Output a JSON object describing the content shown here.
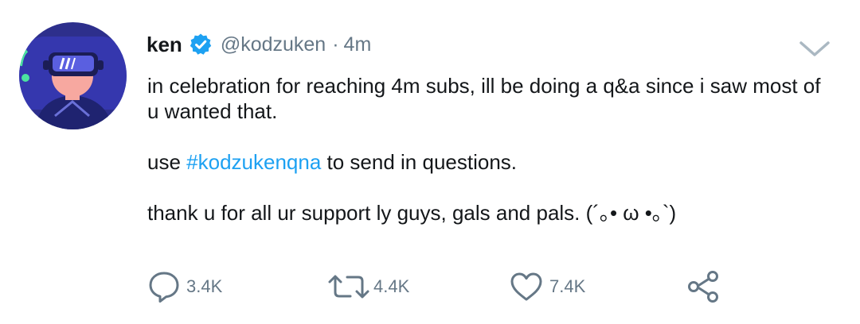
{
  "tweet": {
    "display_name": "ken",
    "handle": "@kodzuken",
    "separator": "·",
    "time": "4m",
    "verified": true,
    "body": {
      "line1": "in celebration for reaching 4m subs, ill be doing a q&a since i saw most of u wanted that.",
      "line2_prefix": "use ",
      "hashtag": "#kodzukenqna",
      "line2_suffix": " to send in questions.",
      "line3": "thank u for all ur support ly guys, gals and pals. (´｡• ω •｡`)"
    },
    "actions": {
      "reply_count": "3.4K",
      "retweet_count": "4.4K",
      "like_count": "7.4K"
    }
  },
  "icons": {
    "verified": "verified-badge-icon",
    "caret": "chevron-down-icon",
    "reply": "reply-icon",
    "retweet": "retweet-icon",
    "like": "heart-icon",
    "share": "share-icon"
  },
  "colors": {
    "accent": "#1da1f2",
    "muted": "#657786",
    "text": "#14171a",
    "avatar_bg": "#2d2f8c"
  }
}
